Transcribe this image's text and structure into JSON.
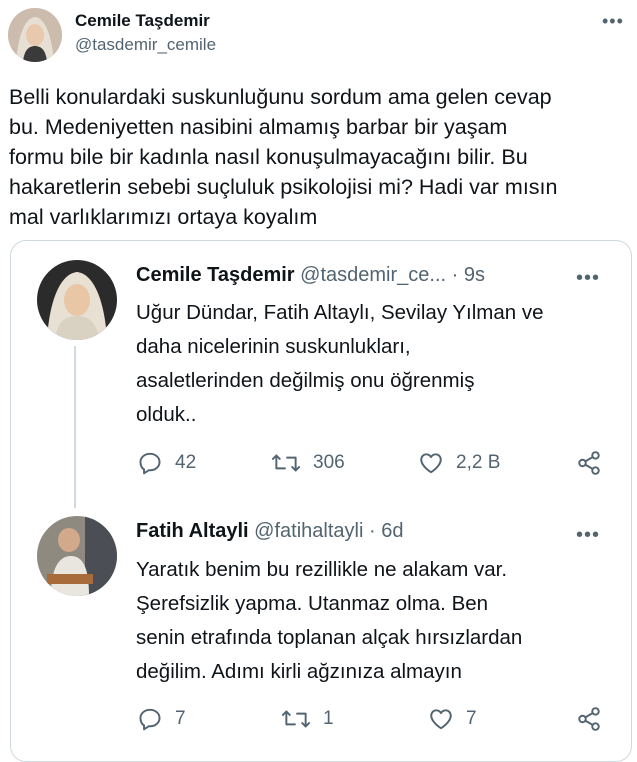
{
  "main_tweet": {
    "author_name": "Cemile Taşdemir",
    "author_handle": "@tasdemir_cemile",
    "text_lines": [
      "Belli konulardaki suskunluğunu sordum ama gelen cevap",
      "bu. Medeniyetten nasibini almamış barbar bir yaşam",
      "formu bile bir kadınla nasıl konuşulmayacağını bilir. Bu",
      "hakaretlerin sebebi suçluluk psikolojisi mi? Hadi var mısın",
      "mal varlıklarımızı ortaya koyalım"
    ]
  },
  "quoted_thread": [
    {
      "author_name": "Cemile Taşdemir",
      "author_handle": "@tasdemir_ce...",
      "separator": "·",
      "time": "9s",
      "text_lines": [
        "Uğur Dündar, Fatih Altaylı, Sevilay Yılman ve",
        "daha nicelerinin suskunlukları,",
        "asaletlerinden değilmiş onu öğrenmiş",
        "olduk.."
      ],
      "replies": "42",
      "retweets": "306",
      "likes": "2,2 B"
    },
    {
      "author_name": "Fatih Altayli",
      "author_handle": "@fatihaltayli",
      "separator": "·",
      "time": "6d",
      "text_lines": [
        "Yaratık benim bu rezillikle ne alakam var.",
        "Şerefsizlik yapma. Utanmaz olma. Ben",
        "senin etrafında toplanan alçak hırsızlardan",
        "değilim. Adımı kirli ağzınıza almayın"
      ],
      "replies": "7",
      "retweets": "1",
      "likes": "7"
    }
  ],
  "icons": {
    "more": "more-icon",
    "reply": "reply-icon",
    "retweet": "retweet-icon",
    "like": "like-icon",
    "share": "share-icon"
  },
  "colors": {
    "text": "#0f1419",
    "muted": "#536471",
    "border": "#cfd9de"
  }
}
